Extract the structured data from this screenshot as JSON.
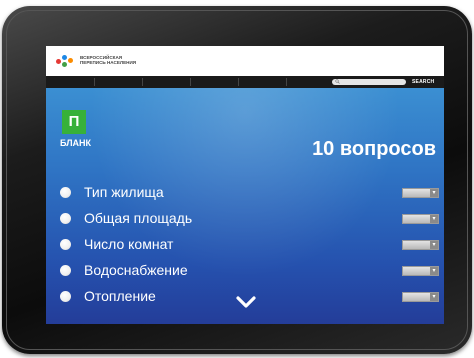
{
  "site": {
    "logo_text": "ВСЕРОССИЙСКАЯ ПЕРЕПИСЬ НАСЕЛЕНИЯ",
    "search_placeholder": "",
    "search_button": "SEARCH"
  },
  "form": {
    "badge_letter": "П",
    "label": "БЛАНК",
    "questions_count": "10 вопросов"
  },
  "questions": [
    {
      "label": "Тип жилища"
    },
    {
      "label": "Общая площадь"
    },
    {
      "label": "Число комнат"
    },
    {
      "label": "Водоснабжение"
    },
    {
      "label": "Отопление"
    }
  ],
  "colors": {
    "badge": "#37b13a",
    "content_top": "#3b8fd2",
    "content_bottom": "#243d99",
    "nav_bar": "#1a1a1a"
  },
  "icons": {
    "scroll": "chevron-down-icon",
    "search": "search-icon",
    "dropdown": "chevron-down-icon"
  }
}
